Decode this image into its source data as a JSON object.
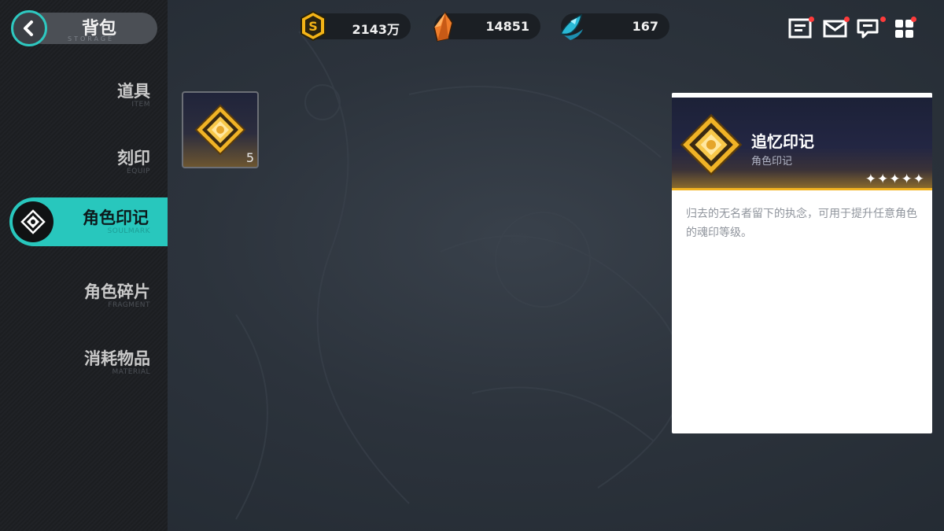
{
  "header": {
    "title": "背包",
    "subtitle": "STORAGE"
  },
  "resources": [
    {
      "icon": "gold-coin-icon",
      "value": "2143万"
    },
    {
      "icon": "orange-crystal-icon",
      "value": "14851"
    },
    {
      "icon": "blue-feather-crystal-icon",
      "value": "167"
    }
  ],
  "top_icons": [
    {
      "name": "task-list-icon",
      "has_dot": true
    },
    {
      "name": "mail-icon",
      "has_dot": true
    },
    {
      "name": "chat-icon",
      "has_dot": true
    },
    {
      "name": "menu-grid-icon",
      "has_dot": true
    }
  ],
  "sidebar": {
    "items": [
      {
        "label": "道具",
        "sub": "ITEM",
        "active": false
      },
      {
        "label": "刻印",
        "sub": "EQUIP",
        "active": false
      },
      {
        "label": "角色印记",
        "sub": "SOULMARK",
        "active": true
      },
      {
        "label": "角色碎片",
        "sub": "FRAGMENT",
        "active": false
      },
      {
        "label": "消耗物品",
        "sub": "MATERIAL",
        "active": false
      }
    ]
  },
  "inventory": {
    "items": [
      {
        "icon": "gold-diamond-soulmark-icon",
        "count": "5"
      }
    ]
  },
  "detail": {
    "name": "追忆印记",
    "type": "角色印记",
    "rarity_stars": 5,
    "description": "归去的无名者留下的执念，可用于提升任意角色的魂印等级。"
  },
  "colors": {
    "accent": "#28c7bd",
    "gold": "#f2b321",
    "notification": "#ff3b3b"
  }
}
